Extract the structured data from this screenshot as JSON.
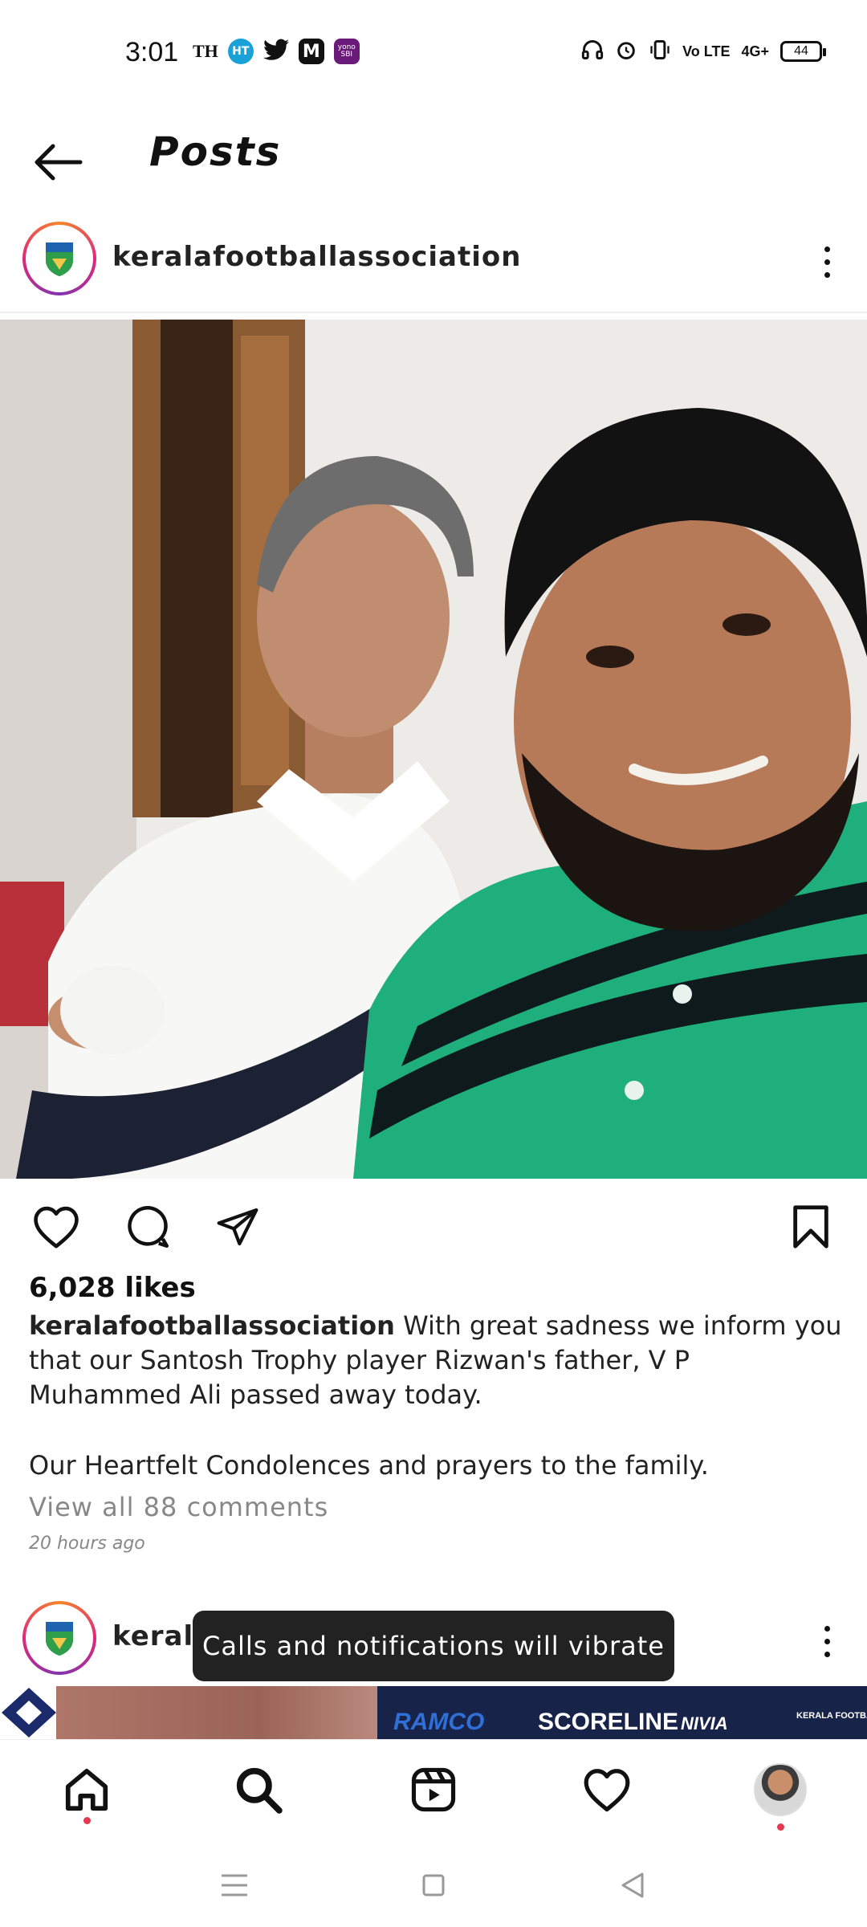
{
  "status_bar": {
    "time": "3:01",
    "left_icons": [
      "TH",
      "HT",
      "twitter-icon",
      "M",
      "yono SBI"
    ],
    "th_label": "TH",
    "ht_label": "HT",
    "m_label": "M",
    "yono_label": "yono SBI",
    "volte_label": "Vo LTE",
    "network_label": "4G+",
    "battery": "44"
  },
  "header": {
    "title": "Posts"
  },
  "post": {
    "username": "keralafootballassociation",
    "likes": "6,028 likes",
    "caption_user": "keralafootballassociation",
    "caption_text": "With great sadness we inform you that our Santosh Trophy player Rizwan's father, V P Muhammed Ali passed away today.",
    "caption_text_2": "Our Heartfelt Condolences and prayers to the family.",
    "view_comments": "View all 88 comments",
    "time_ago": "20 hours ago"
  },
  "post2": {
    "username_partial": "kerala",
    "banner_texts": [
      "RAMCO",
      "SCORELINE",
      "NIVIA",
      "KERALA FOOTBALL ASSOCIATION"
    ]
  },
  "toast": {
    "message": "Calls and notifications will vibrate"
  },
  "colors": {
    "accent_red": "#e53950",
    "toast_bg": "#222222",
    "muted_text": "#888888"
  }
}
